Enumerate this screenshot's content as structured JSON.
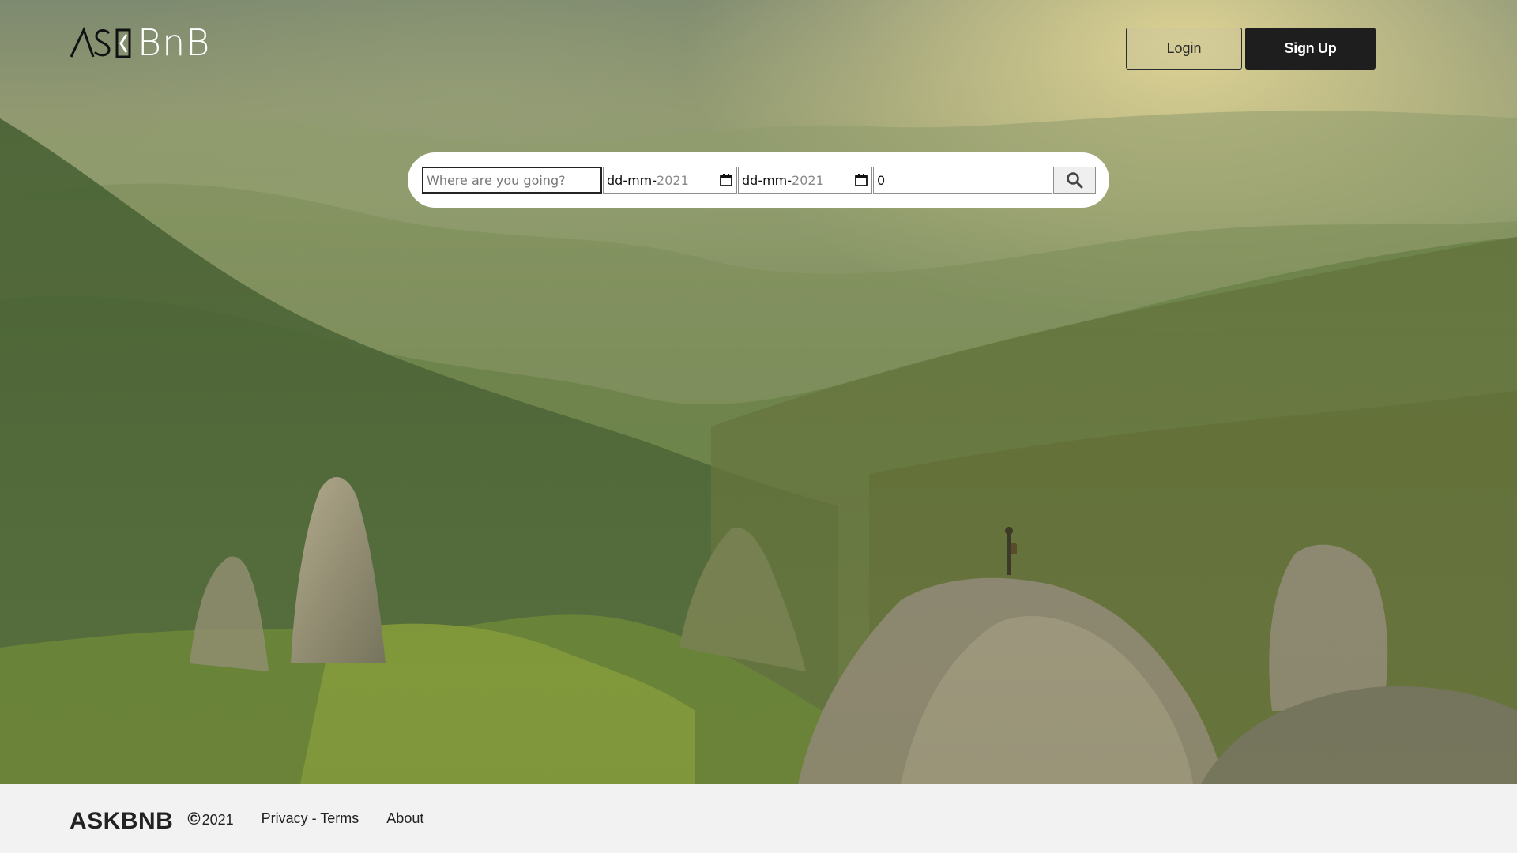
{
  "header": {
    "logo_text": "BnB",
    "logo_mark": "ASK",
    "login_label": "Login",
    "signup_label": "Sign Up"
  },
  "search": {
    "destination_placeholder": "Where are you going?",
    "checkin": {
      "prefix": "dd-mm-",
      "year": "2021"
    },
    "checkout": {
      "prefix": "dd-mm-",
      "year": "2021"
    },
    "guests_value": "0",
    "icons": {
      "calendar": "calendar-icon",
      "search": "search-icon"
    }
  },
  "footer": {
    "brand": "ASKBNB",
    "copyright_symbol": "©",
    "year": "2021",
    "privacy_terms": "Privacy - Terms",
    "about": "About"
  },
  "colors": {
    "signup_bg": "#1e1e1e",
    "footer_bg": "#f2f2f2",
    "text_dark": "#222222"
  }
}
